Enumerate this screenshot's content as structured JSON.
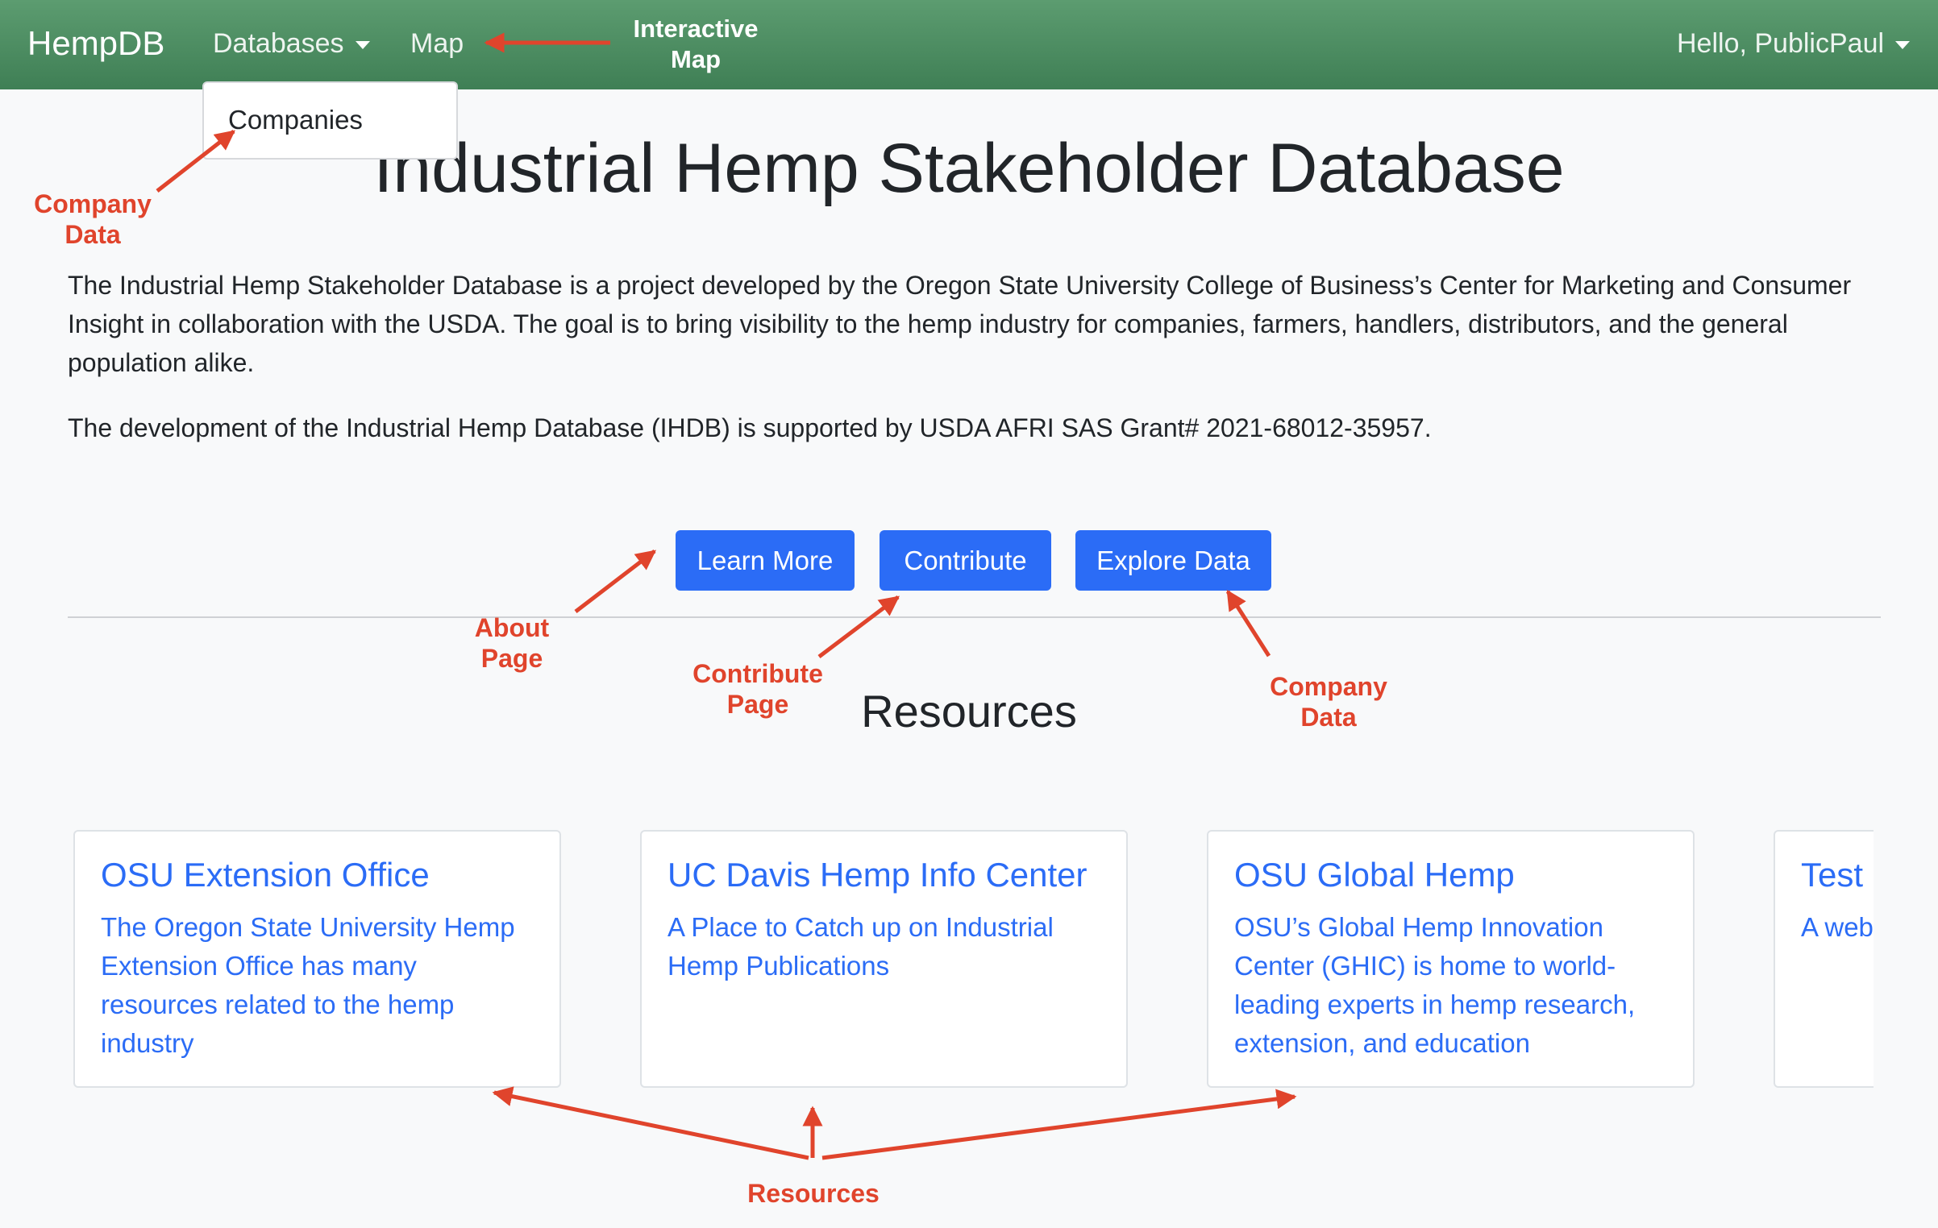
{
  "navbar": {
    "brand": "HempDB",
    "databases_label": "Databases",
    "map_label": "Map",
    "user_label": "Hello, PublicPaul"
  },
  "dropdown": {
    "items": [
      {
        "label": "Companies"
      }
    ]
  },
  "main": {
    "title": "Industrial Hemp Stakeholder Database",
    "intro": "The Industrial Hemp Stakeholder Database is a project developed by the Oregon State University College of Business’s Center for Marketing and Consumer Insight in collaboration with the USDA. The goal is to bring visibility to the hemp industry for companies, farmers, handlers, distributors, and the general population alike.",
    "grant": "The development of the Industrial Hemp Database (IHDB) is supported by USDA AFRI SAS Grant# 2021-68012-35957.",
    "buttons": {
      "learn_more": "Learn More",
      "contribute": "Contribute",
      "explore": "Explore Data"
    }
  },
  "resources": {
    "title": "Resources",
    "cards": [
      {
        "title": "OSU Extension Office",
        "text": "The Oregon State University Hemp Extension Office has many resources related to the hemp industry"
      },
      {
        "title": "UC Davis Hemp Info Center",
        "text": "A Place to Catch up on Industrial Hemp Publications"
      },
      {
        "title": "OSU Global Hemp",
        "text": "OSU’s Global Hemp Innovation Center (GHIC) is home to world-leading experts in hemp research, extension, and education"
      },
      {
        "title": "Test",
        "text": "A web"
      }
    ]
  },
  "annotations": {
    "interactive_map": [
      "Interactive",
      "Map"
    ],
    "company_data_top": [
      "Company",
      "Data"
    ],
    "about_page": [
      "About",
      "Page"
    ],
    "contribute_page": [
      "Contribute",
      "Page"
    ],
    "company_data_bottom": [
      "Company",
      "Data"
    ],
    "resources": "Resources"
  },
  "colors": {
    "navbar": "#4a8a5f",
    "primary": "#2b6cf6",
    "annotation": "#e0442c"
  }
}
